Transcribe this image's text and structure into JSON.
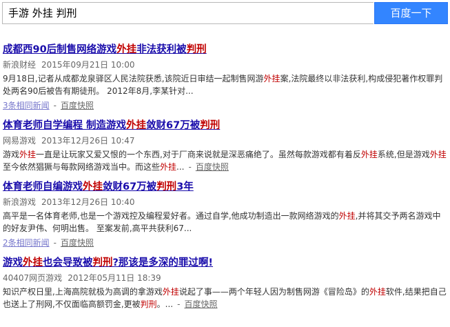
{
  "search": {
    "query": "手游 外挂 判刑",
    "button_label": "百度一下"
  },
  "results": [
    {
      "title_parts": [
        "成都西90后制售网络游戏",
        "外挂",
        "非法获利被",
        "判刑",
        ""
      ],
      "source": "新浪财经",
      "date": "2015年09月21日 10:00",
      "abstract_parts": [
        "9月18日,记者从成都龙泉驿区人民法院获悉,该院近日审结一起制售网游",
        "外挂",
        "案,法院最终以非法获利,构成侵犯著作权罪判处两名90后被告有期徒刑。 2012年8月,李某针对..."
      ],
      "related": "3条相同新闻",
      "snapshot": "百度快照"
    },
    {
      "title_parts": [
        "体育老师自学编程 制造游戏",
        "外挂",
        "敛财67万被",
        "判刑",
        ""
      ],
      "source": "网易游戏",
      "date": "2013年12月26日 10:47",
      "abstract_parts": [
        "游戏",
        "外挂",
        "一直是让玩家又爱又恨的一个东西,对于厂商来说就是深恶痛绝了。虽然每款游戏都有着反",
        "外挂",
        "系统,但是游戏",
        "外挂",
        "至今依然猖獗与每款网络游戏当中。而这些",
        "外挂",
        "..."
      ],
      "related": "",
      "snapshot": "百度快照"
    },
    {
      "title_parts": [
        "体育老师自编游戏",
        "外挂",
        "敛财67万被",
        "判刑",
        "3年"
      ],
      "source": "新浪游戏",
      "date": "2013年12月26日 10:40",
      "abstract_parts": [
        "高平是一名体育老师,也是一个游戏控及编程爱好者。通过自学,他成功制造出一款网络游戏的",
        "外挂",
        ",并将其交予两名游戏中的好友尹伟、何明出售。 至案发前,高平共获利67..."
      ],
      "related": "2条相同新闻",
      "snapshot": "百度快照"
    },
    {
      "title_parts": [
        "游戏",
        "外挂",
        "也会导致被",
        "判刑",
        "?那该是多深的罪过啊!"
      ],
      "source": "40407网页游戏",
      "date": "2012年05月11日 18:39",
      "abstract_parts": [
        "知识产权日里,上海高院就极为高调的拿游戏",
        "外挂",
        "说起了事——两个年轻人因为制售网游《冒险岛》的",
        "外挂",
        "软件,结果把自己也送上了刑网,不仅面临高额罚金,更被",
        "判刑",
        "。..."
      ],
      "related": "",
      "snapshot": "百度快照"
    }
  ]
}
